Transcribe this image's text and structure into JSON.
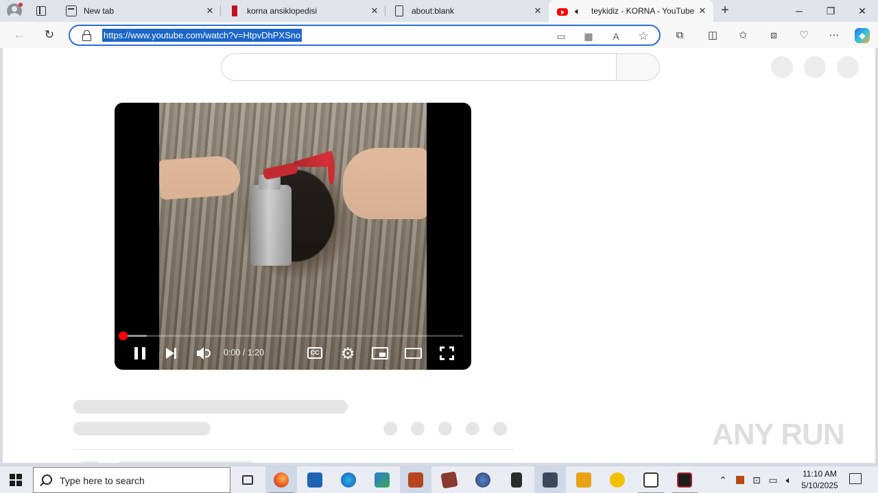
{
  "browser": {
    "tabs": [
      {
        "title": "New tab",
        "icon": "new-tab-page-icon"
      },
      {
        "title": "korna ansiklopedisi",
        "icon": "eksi-sozluk-icon"
      },
      {
        "title": "about:blank",
        "icon": "blank-page-icon"
      },
      {
        "title": "teykidiz - KORNA - YouTube",
        "icon": "youtube-icon",
        "active": true,
        "audio": "speaker-icon"
      }
    ],
    "new_tab_symbol": "+",
    "window_controls": {
      "minimize": "─",
      "restore": "❐",
      "close": "✕"
    },
    "address": {
      "url": "https://www.youtube.com/watch?v=HtpvDhPXSno"
    },
    "accent_color": "#2b6de0"
  },
  "youtube": {
    "player": {
      "time": "0:00 / 1:20",
      "progress_fraction": 0.0,
      "buffered_fraction": 0.07,
      "cc_label": "CC"
    }
  },
  "watermark": "ANY RUN",
  "taskbar": {
    "search_placeholder": "Type here to search",
    "time": "11:10 AM",
    "date": "5/10/2025"
  }
}
